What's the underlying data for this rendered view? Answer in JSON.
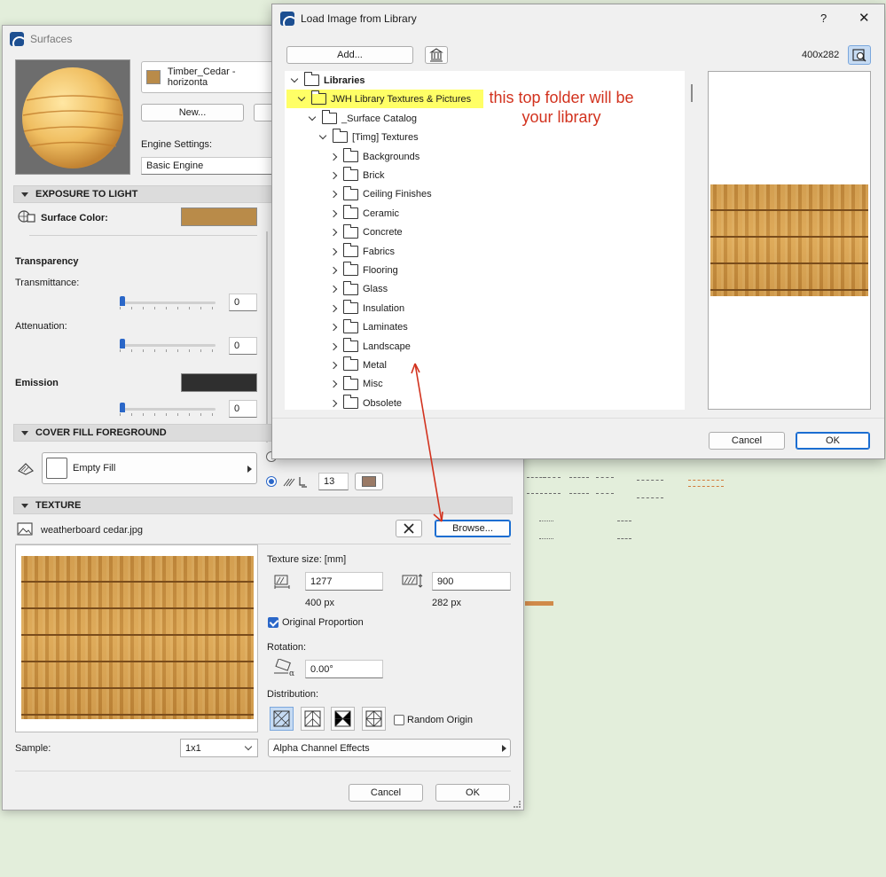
{
  "surfaces": {
    "title": "Surfaces",
    "material_name": "Timber_Cedar - horizonta",
    "new_button": "New...",
    "engine_settings_label": "Engine Settings:",
    "engine_value": "Basic Engine",
    "exposure_header": "EXPOSURE TO LIGHT",
    "surface_color_label": "Surface Color:",
    "surface_color": "#b98b49",
    "transparency_heading": "Transparency",
    "transmittance_label": "Transmittance:",
    "transmittance_value": "0",
    "attenuation_label": "Attenuation:",
    "attenuation_value": "0",
    "emission_heading": "Emission",
    "emission_value": "0",
    "emission_color": "#2f2f2f",
    "cover_fill_header": "COVER FILL FOREGROUND",
    "fill_value": "Empty Fill",
    "fill_pen_value": "13",
    "texture_header": "TEXTURE",
    "texture_file": "weatherboard cedar.jpg",
    "browse_button": "Browse...",
    "texture_size_label": "Texture size: [mm]",
    "width_mm": "1277",
    "height_mm": "900",
    "width_px": "400 px",
    "height_px": "282 px",
    "original_proportion_label": "Original Proportion",
    "original_proportion_checked": true,
    "rotation_label": "Rotation:",
    "rotation_value": "0.00°",
    "distribution_label": "Distribution:",
    "random_origin_label": "Random Origin",
    "sample_label": "Sample:",
    "sample_value": "1x1",
    "alpha_value": "Alpha Channel Effects",
    "cancel_button": "Cancel",
    "ok_button": "OK"
  },
  "load_dialog": {
    "title": "Load Image from Library",
    "help_label": "?",
    "close_label": "✕",
    "add_button": "Add...",
    "image_size": "400x282",
    "tree": {
      "root": "Libraries",
      "library": "JWH Library Textures & Pictures",
      "catalog": "_Surface Catalog",
      "textures": "[Timg] Textures",
      "folders": [
        "Backgrounds",
        "Brick",
        "Ceiling Finishes",
        "Ceramic",
        "Concrete",
        "Fabrics",
        "Flooring",
        "Glass",
        "Insulation",
        "Laminates",
        "Landscape",
        "Metal",
        "Misc",
        "Obsolete"
      ]
    },
    "cancel_button": "Cancel",
    "ok_button": "OK"
  },
  "annotation": {
    "line1": "this top folder will be",
    "line2": "your library",
    "color": "#d2321e"
  }
}
